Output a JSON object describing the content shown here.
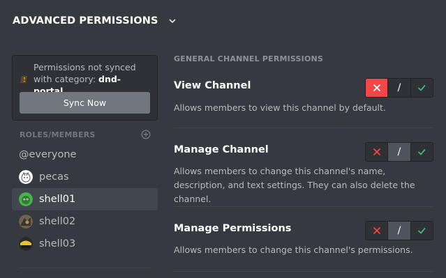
{
  "section": {
    "title": "ADVANCED PERMISSIONS",
    "chevron_icon": "chevron-down-icon"
  },
  "sync": {
    "icon": "warning-icon",
    "text": "Permissions not synced with category: ",
    "category": "dnd-portal",
    "button_label": "Sync Now"
  },
  "roles": {
    "header": "ROLES/MEMBERS",
    "add_icon": "add-circle-icon",
    "items": [
      {
        "label": "@everyone",
        "avatar": null,
        "active": false
      },
      {
        "label": "pecas",
        "avatar": "avatar-pecas",
        "active": false
      },
      {
        "label": "shell01",
        "avatar": "avatar-shell01",
        "active": true
      },
      {
        "label": "shell02",
        "avatar": "avatar-shell02",
        "active": false
      },
      {
        "label": "shell03",
        "avatar": "avatar-shell03",
        "active": false
      }
    ]
  },
  "main": {
    "header": "GENERAL CHANNEL PERMISSIONS",
    "permissions": [
      {
        "title": "View Channel",
        "description": "Allows members to view this channel by default.",
        "state": "deny"
      },
      {
        "title": "Manage Channel",
        "description": "Allows members to change this channel's name, description, and text settings. They can also delete the channel.",
        "state": "neutral"
      },
      {
        "title": "Manage Permissions",
        "description": "Allows members to change this channel's permissions.",
        "state": "neutral"
      }
    ],
    "toggle_neutral_glyph": "/"
  },
  "colors": {
    "background": "#36393f",
    "deny": "#f04747",
    "allow": "#43b581",
    "neutral_on": "#4f545c",
    "button": "#72767d"
  }
}
